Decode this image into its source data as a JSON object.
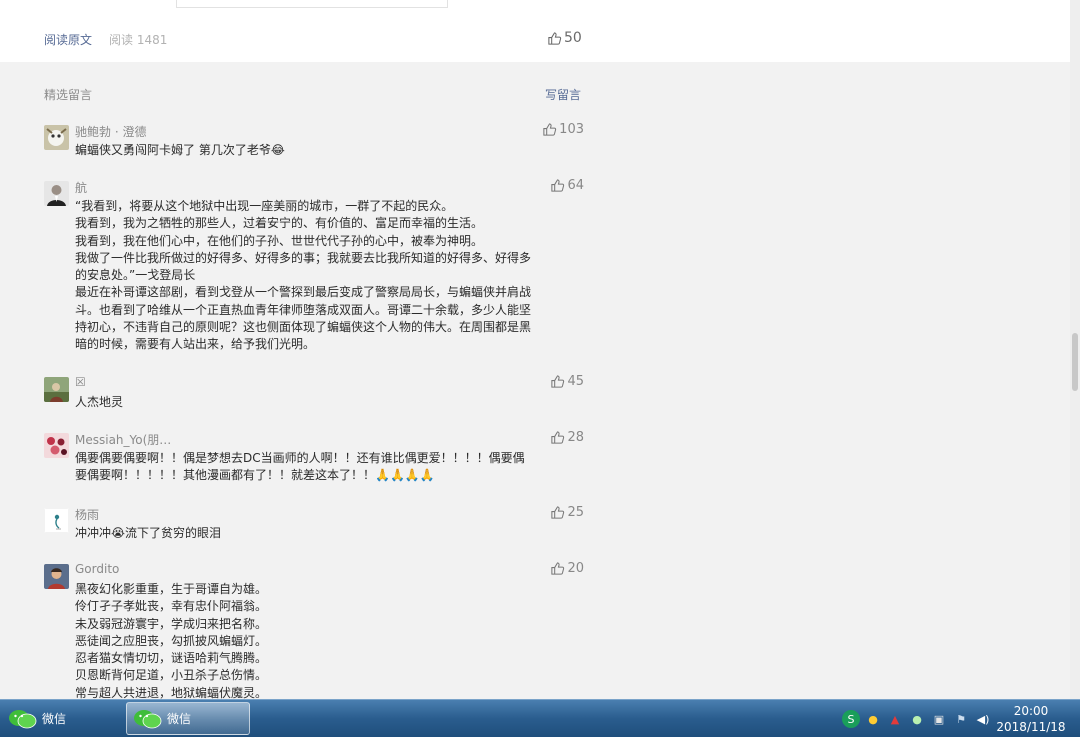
{
  "article_footer": {
    "read_original": "阅读原文",
    "read_count": "阅读 1481",
    "likes": "50"
  },
  "comments_section": {
    "title": "精选留言",
    "write_label": "写留言",
    "items": [
      {
        "nick": "驰鲍勃 · 澄德",
        "likes": "103",
        "lines": [
          "蝙蝠侠又勇闯阿卡姆了 第几次了老爷😂"
        ]
      },
      {
        "nick": "航",
        "likes": "64",
        "lines": [
          "“我看到，将要从这个地狱中出现一座美丽的城市，一群了不起的民众。",
          "我看到，我为之牺牲的那些人，过着安宁的、有价值的、富足而幸福的生活。",
          "我看到，我在他们心中，在他们的子孙、世世代代子孙的心中，被奉为神明。",
          "我做了一件比我所做过的好得多、好得多的事；我就要去比我所知道的好得多、好得多",
          "的安息处。”一戈登局长",
          "最近在补哥谭这部剧，看到戈登从一个警探到最后变成了警察局局长，与蝙蝠侠并肩战",
          "斗。也看到了哈维从一个正直热血青年律师堕落成双面人。哥谭二十余载，多少人能坚",
          "持初心，不违背自己的原则呢？这也侧面体现了蝙蝠侠这个人物的伟大。在周围都是黑",
          "暗的时候，需要有人站出来，给予我们光明。"
        ]
      },
      {
        "nick": "☒",
        "likes": "45",
        "lines": [
          "人杰地灵"
        ]
      },
      {
        "nick": "Messiah_Yo(朋…",
        "likes": "28",
        "lines": [
          "偶要偶要偶要啊！！偶是梦想去DC当画师的人啊！！还有谁比偶更爱！！！！偶要偶",
          "要偶要啊！！！！！其他漫画都有了！！就差这本了！！🙏🙏🙏🙏"
        ]
      },
      {
        "nick": "杨雨",
        "likes": "25",
        "lines": [
          "冲冲冲😭流下了贫穷的眼泪"
        ]
      },
      {
        "nick": "Gordito",
        "likes": "20",
        "lines": [
          "黑夜幻化影重重，生于哥谭自为雄。",
          "伶仃孑子孝妣丧，幸有忠仆阿福翁。",
          "未及弱冠游寰宇，学成归来把名称。",
          "恶徒闻之应胆丧，勾抓披风蝙蝠灯。",
          "忍者猫女情切切，谜语哈莉气腾腾。",
          "贝恩断背何足道，小丑杀子总伤情。",
          "常与超人共进退，地狱蝙蝠伏魔灵。"
        ]
      }
    ]
  },
  "taskbar": {
    "tasks": [
      {
        "label": "微信"
      },
      {
        "label": "微信"
      }
    ],
    "time": "20:00",
    "date": "2018/11/18"
  }
}
